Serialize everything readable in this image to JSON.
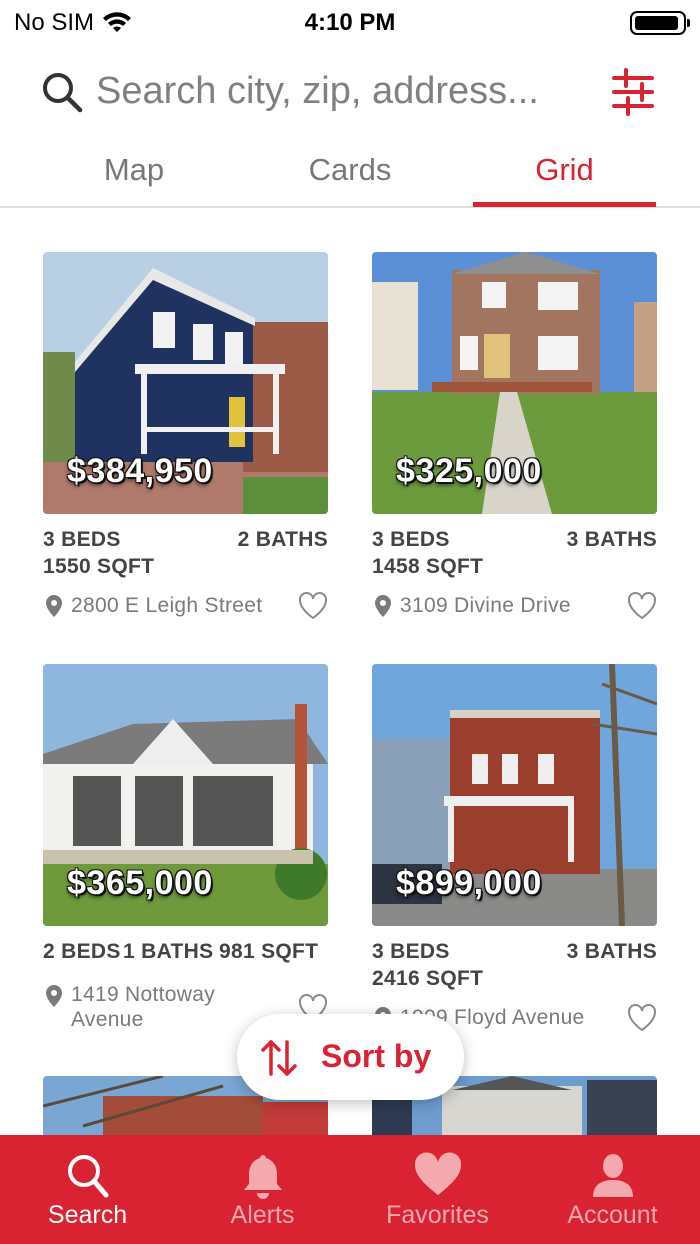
{
  "status_bar": {
    "carrier": "No SIM",
    "time": "4:10 PM"
  },
  "search": {
    "placeholder": "Search city, zip, address..."
  },
  "tabs": [
    {
      "label": "Map"
    },
    {
      "label": "Cards"
    },
    {
      "label": "Grid",
      "active": true
    }
  ],
  "listings": [
    {
      "price": "$384,950",
      "beds": "3 BEDS",
      "baths": "2 BATHS",
      "sqft": "1550 SQFT",
      "address": "2800 E Leigh Street"
    },
    {
      "price": "$325,000",
      "beds": "3 BEDS",
      "baths": "3 BATHS",
      "sqft": "1458 SQFT",
      "address": "3109 Divine Drive"
    },
    {
      "price": "$365,000",
      "beds": "2 BEDS",
      "baths": "1 BATHS",
      "sqft": "981 SQFT",
      "address": "1419 Nottoway Avenue"
    },
    {
      "price": "$899,000",
      "beds": "3 BEDS",
      "baths": "3 BATHS",
      "sqft": "2416 SQFT",
      "address": "1909 Floyd Avenue"
    }
  ],
  "sort": {
    "label": "Sort by"
  },
  "bottom_nav": [
    {
      "label": "Search",
      "icon": "search-icon",
      "active": true
    },
    {
      "label": "Alerts",
      "icon": "bell-icon"
    },
    {
      "label": "Favorites",
      "icon": "heart-icon"
    },
    {
      "label": "Account",
      "icon": "person-icon"
    }
  ],
  "colors": {
    "accent": "#d92332",
    "nav_background": "#da2332",
    "inactive_tab": "#777777"
  }
}
